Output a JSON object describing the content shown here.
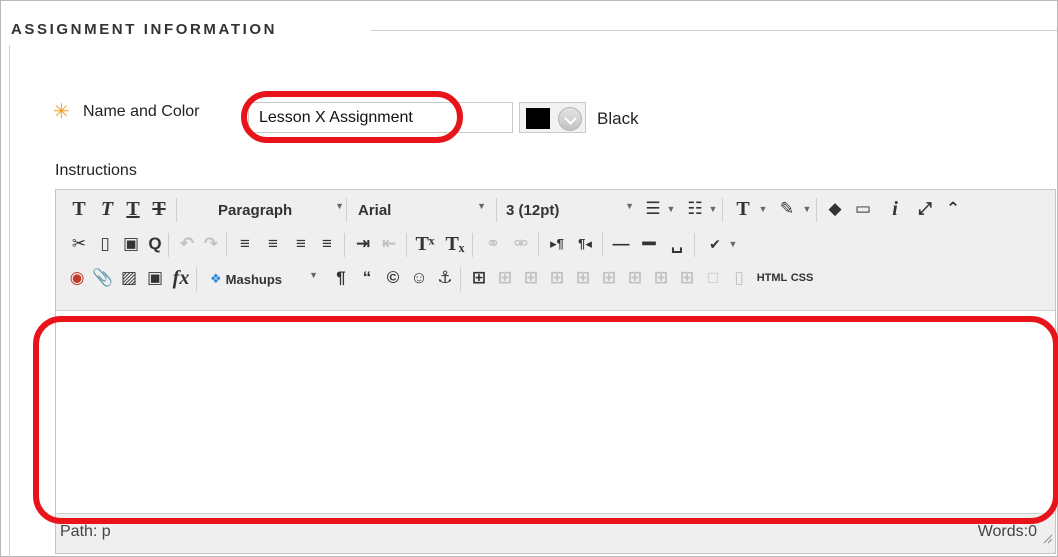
{
  "section": {
    "title": "ASSIGNMENT INFORMATION"
  },
  "name_field": {
    "label": "Name and Color",
    "value": "Lesson X Assignment",
    "required_icon": "asterisk-icon"
  },
  "color": {
    "selected": "Black",
    "swatch": "#000000"
  },
  "instructions": {
    "label": "Instructions",
    "toolbar": {
      "format_dropdown": "Paragraph",
      "font_dropdown": "Arial",
      "size_dropdown": "3 (12pt)",
      "mashups_label": "Mashups",
      "html_label": "HTML",
      "css_label": "CSS"
    },
    "status": {
      "path": "Path: p",
      "words": "Words:0"
    }
  },
  "colors": {
    "highlight": "#e8141a",
    "required": "#f09c1d"
  }
}
